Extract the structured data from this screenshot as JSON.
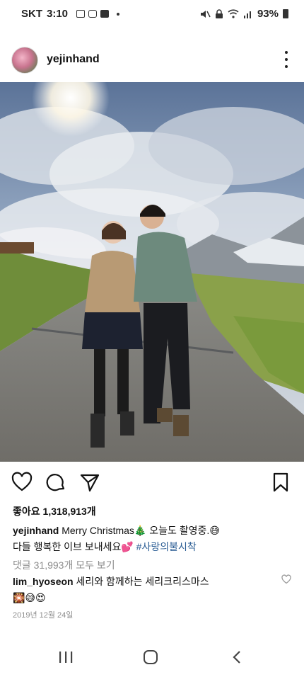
{
  "status_bar": {
    "carrier": "SKT",
    "time": "3:10",
    "battery": "93%"
  },
  "post": {
    "username": "yejinhand",
    "likes_label": "좋아요 1,318,913개",
    "caption": {
      "username": "yejinhand",
      "text_line1": "Merry Christmas🎄 오늘도 촬영중.😅",
      "text_line2": "다들 행복한 이브 보내세요💕",
      "hashtag": "#사랑의불시착"
    },
    "view_comments": "댓글 31,993개 모두 보기",
    "comment": {
      "username": "lim_hyoseon",
      "text": "세리와 함께하는 세리크리스마스",
      "emojis": "🎇😅😍"
    },
    "date": "2019년 12월 24일"
  },
  "icons": {
    "like": "heart-icon",
    "comment": "comment-bubble-icon",
    "share": "paper-plane-icon",
    "save": "bookmark-icon",
    "more": "more-vertical-icon"
  }
}
